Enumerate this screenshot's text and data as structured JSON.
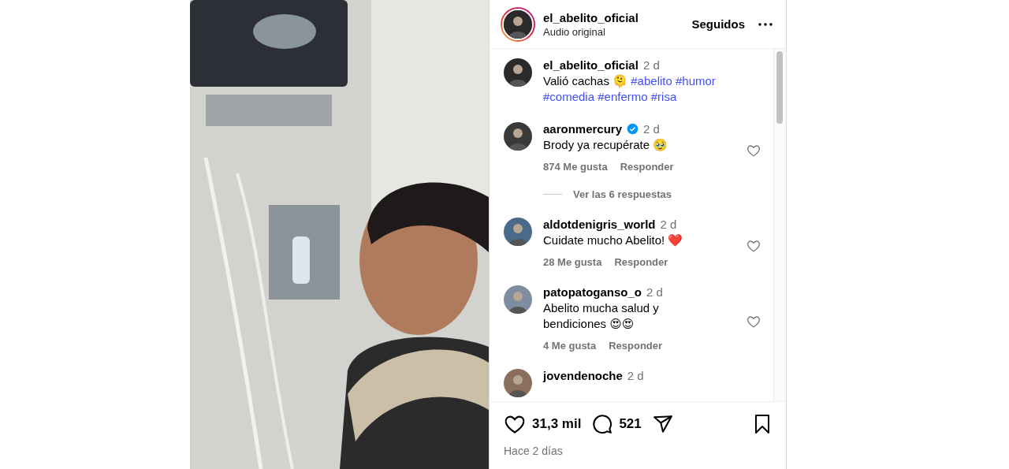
{
  "post": {
    "author": {
      "username": "el_abelito_oficial",
      "audio": "Audio original",
      "story_ring": true
    },
    "follow_button": "Seguidos",
    "caption": {
      "username": "el_abelito_oficial",
      "time": "2 d",
      "text": "Valió cachas 🫠",
      "hashtags": [
        "#abelito",
        "#humor",
        "#comedia",
        "#enfermo",
        "#risa"
      ]
    },
    "comments": [
      {
        "username": "aaronmercury",
        "verified": true,
        "time": "2 d",
        "text": "Brody ya recupérate 🥹",
        "likes": "874 Me gusta",
        "reply": "Responder",
        "liked": false,
        "replies": "Ver las 6 respuestas"
      },
      {
        "username": "aldotdenigris_world",
        "verified": false,
        "time": "2 d",
        "text": "Cuidate mucho Abelito! ❤️",
        "likes": "28 Me gusta",
        "reply": "Responder",
        "liked": false
      },
      {
        "username": "patopatoganso_o",
        "verified": false,
        "time": "2 d",
        "text": "Abelito mucha salud y bendiciones 😍😍",
        "likes": "4 Me gusta",
        "reply": "Responder",
        "liked": false
      },
      {
        "username": "jovendenoche",
        "verified": false,
        "time": "2 d"
      }
    ],
    "actions": {
      "liked": false,
      "like_count": "31,3 mil",
      "comment_count": "521",
      "saved": false
    },
    "date": "Hace 2 días"
  }
}
